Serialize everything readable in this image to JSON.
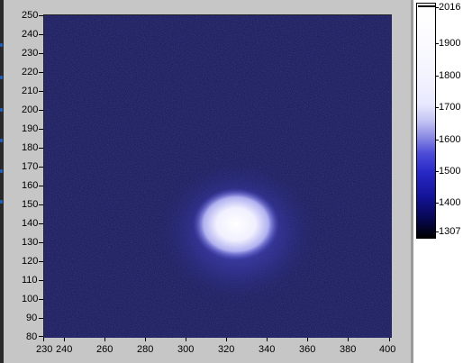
{
  "plot": {
    "y_ticks": [
      "250",
      "240",
      "230",
      "220",
      "210",
      "200",
      "190",
      "180",
      "170",
      "160",
      "150",
      "140",
      "130",
      "120",
      "110",
      "100",
      "90",
      "80"
    ],
    "x_ticks": [
      "230",
      "240",
      "260",
      "280",
      "300",
      "320",
      "340",
      "360",
      "380",
      "400"
    ]
  },
  "colorbar": {
    "labels": [
      "2016",
      "1900",
      "1800",
      "1700",
      "1600",
      "1500",
      "1400",
      "1307"
    ]
  },
  "chart_data": {
    "type": "heatmap",
    "xlim": [
      230,
      400
    ],
    "ylim": [
      80,
      250
    ],
    "x_ticks": [
      230,
      240,
      260,
      280,
      300,
      320,
      340,
      360,
      380,
      400
    ],
    "y_ticks": [
      80,
      90,
      100,
      110,
      120,
      130,
      140,
      150,
      160,
      170,
      180,
      190,
      200,
      210,
      220,
      230,
      240,
      250
    ],
    "colorbar": {
      "min": 1307,
      "max": 2016,
      "ticks": [
        1307,
        1400,
        1500,
        1600,
        1700,
        1800,
        1900,
        2016
      ]
    },
    "features": [
      {
        "center_x": 324,
        "center_y": 138,
        "peak": 2016,
        "background": 1330
      }
    ],
    "colors": {
      "background": "#1e1f5e",
      "peak": "#ffffff",
      "mid": "#4c4cd8"
    }
  }
}
